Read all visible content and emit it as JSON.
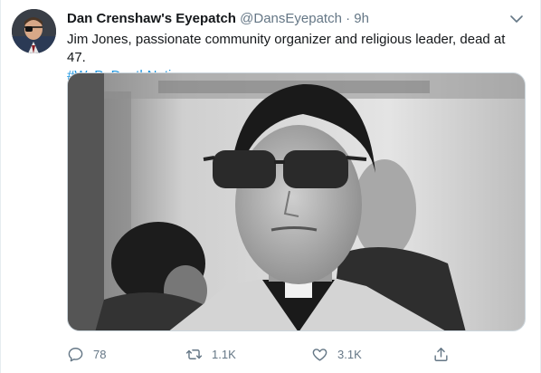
{
  "author": {
    "display_name": "Dan Crenshaw's Eyepatch",
    "handle": "@DansEyepatch",
    "separator": "·",
    "time": "9h"
  },
  "tweet": {
    "text": "Jim Jones, passionate community organizer and religious leader, dead at 47.",
    "hashtag": "#WaPoDeathNotices"
  },
  "actions": {
    "reply_count": "78",
    "retweet_count": "1.1K",
    "like_count": "3.1K"
  },
  "icons": {
    "menu": "chevron-down-icon",
    "reply": "reply-icon",
    "retweet": "retweet-icon",
    "like": "heart-icon",
    "share": "share-icon"
  },
  "colors": {
    "text": "#14171a",
    "muted": "#657786",
    "link": "#1b95e0",
    "border": "#e6ecf0"
  }
}
